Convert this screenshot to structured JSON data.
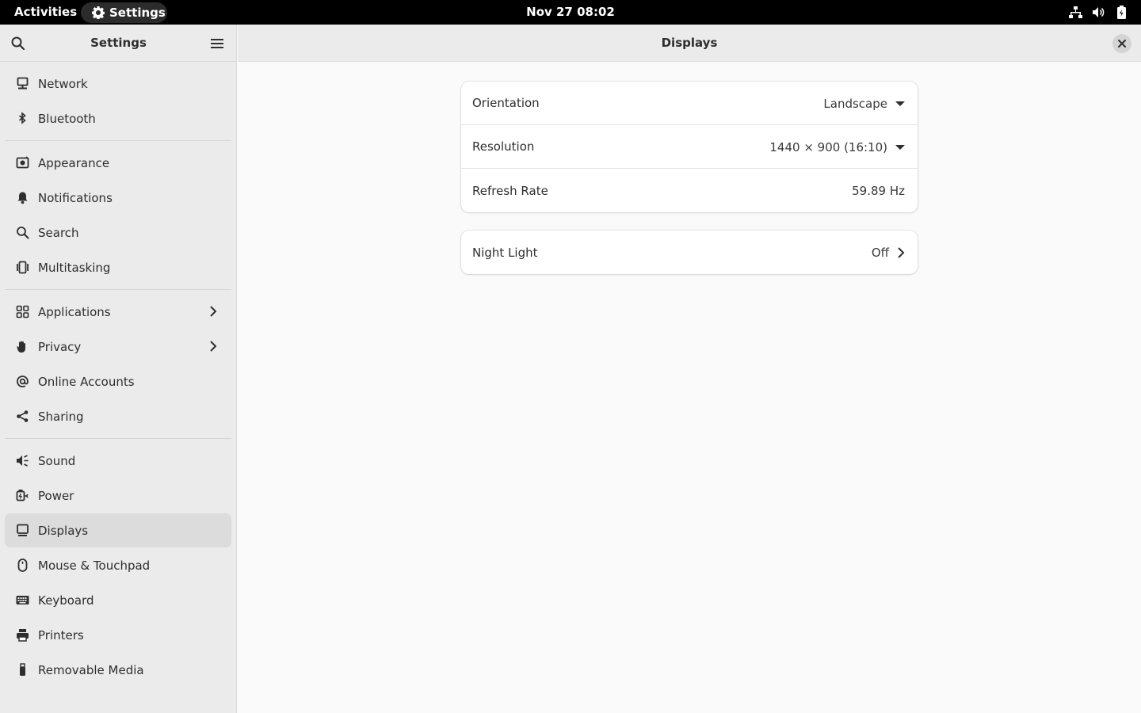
{
  "topbar": {
    "activities": "Activities",
    "app_name": "Settings",
    "clock": "Nov 27  08:02",
    "tray_icons": [
      "network-wired-icon",
      "volume-icon",
      "battery-icon"
    ]
  },
  "sidebar": {
    "title": "Settings",
    "groups": [
      [
        {
          "label": "Network",
          "icon": "network-icon"
        },
        {
          "label": "Bluetooth",
          "icon": "bluetooth-icon"
        }
      ],
      [
        {
          "label": "Appearance",
          "icon": "appearance-icon"
        },
        {
          "label": "Notifications",
          "icon": "bell-icon"
        },
        {
          "label": "Search",
          "icon": "search-icon"
        },
        {
          "label": "Multitasking",
          "icon": "multitasking-icon"
        }
      ],
      [
        {
          "label": "Applications",
          "icon": "apps-grid-icon",
          "chevron": true
        },
        {
          "label": "Privacy",
          "icon": "hand-icon",
          "chevron": true
        },
        {
          "label": "Online Accounts",
          "icon": "at-sign-icon"
        },
        {
          "label": "Sharing",
          "icon": "share-icon"
        }
      ],
      [
        {
          "label": "Sound",
          "icon": "speaker-icon"
        },
        {
          "label": "Power",
          "icon": "power-plug-icon"
        },
        {
          "label": "Displays",
          "icon": "display-icon",
          "active": true
        },
        {
          "label": "Mouse & Touchpad",
          "icon": "mouse-icon"
        },
        {
          "label": "Keyboard",
          "icon": "keyboard-icon"
        },
        {
          "label": "Printers",
          "icon": "printer-icon"
        },
        {
          "label": "Removable Media",
          "icon": "usb-stick-icon"
        }
      ]
    ]
  },
  "main": {
    "title": "Displays",
    "display_settings": {
      "orientation_label": "Orientation",
      "orientation_value": "Landscape",
      "resolution_label": "Resolution",
      "resolution_value": "1440 × 900 (16:10)",
      "refresh_label": "Refresh Rate",
      "refresh_value": "59.89 Hz"
    },
    "night_light": {
      "label": "Night Light",
      "value": "Off"
    }
  }
}
